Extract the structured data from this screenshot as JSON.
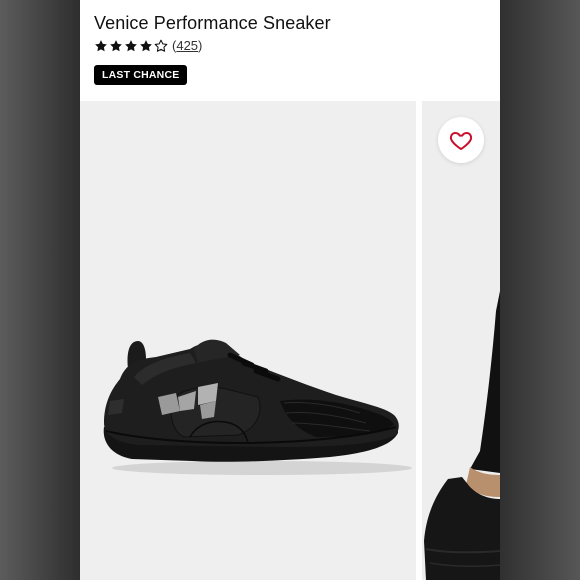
{
  "product": {
    "title": "Venice Performance Sneaker",
    "rating": 4,
    "max_rating": 5,
    "review_count": "425",
    "badge": "LAST CHANCE"
  },
  "gallery": {
    "main_image_alt": "black sneaker",
    "secondary_image_alt": "sneaker on foot",
    "favorite_icon": "heart-icon"
  },
  "colors": {
    "background": "#efefef",
    "accent_heart": "#c8102e",
    "badge_bg": "#000000",
    "badge_text": "#ffffff"
  }
}
